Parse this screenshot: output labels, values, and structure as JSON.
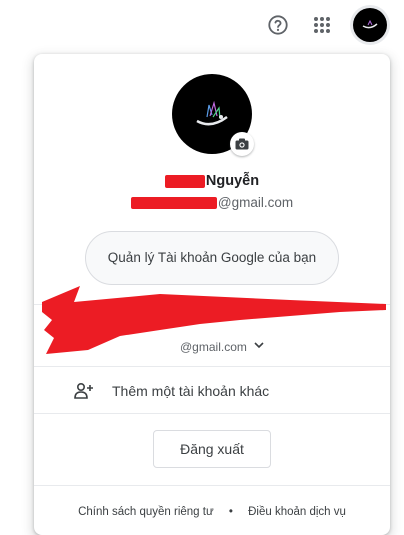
{
  "header": {
    "help_icon": "help-circle-icon",
    "apps_icon": "apps-grid-icon",
    "avatar": "profile-avatar"
  },
  "profile": {
    "name_visible": "Nguyễn",
    "email_visible": "@gmail.com",
    "camera_icon": "camera-icon"
  },
  "manage_account": {
    "label": "Quản lý Tài khoản Google của bạn"
  },
  "other_account": {
    "email_visible": "@gmail.com",
    "icon": "chevron-down-icon"
  },
  "add_account": {
    "label": "Thêm một tài khoản khác",
    "icon": "person-add-icon"
  },
  "logout": {
    "label": "Đăng xuất"
  },
  "footer": {
    "privacy": "Chính sách quyền riêng tư",
    "separator": "•",
    "terms": "Điều khoản dịch vụ"
  },
  "colors": {
    "redaction": "#ec1c24",
    "divider": "#e8eaed"
  }
}
